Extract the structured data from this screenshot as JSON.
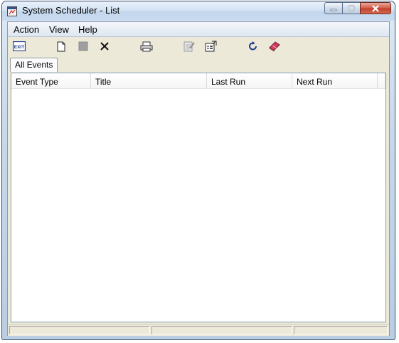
{
  "window": {
    "title": "System Scheduler - List"
  },
  "menu": {
    "items": [
      {
        "label": "Action"
      },
      {
        "label": "View"
      },
      {
        "label": "Help"
      }
    ]
  },
  "toolbar": {
    "exit_label": "EXIT",
    "buttons": [
      {
        "name": "exit-icon"
      },
      {
        "name": "new-document-icon"
      },
      {
        "name": "stop-icon"
      },
      {
        "name": "delete-icon"
      },
      {
        "name": "printer-icon"
      },
      {
        "name": "edit-icon"
      },
      {
        "name": "properties-icon"
      },
      {
        "name": "refresh-icon"
      },
      {
        "name": "help-book-icon"
      }
    ]
  },
  "tabs": [
    {
      "label": "All Events"
    }
  ],
  "list": {
    "columns": [
      "Event Type",
      "Title",
      "Last Run",
      "Next Run"
    ],
    "rows": []
  },
  "colors": {
    "close_button": "#c0402b",
    "titlebar": "#d4e3f3",
    "face": "#ece9d8"
  }
}
